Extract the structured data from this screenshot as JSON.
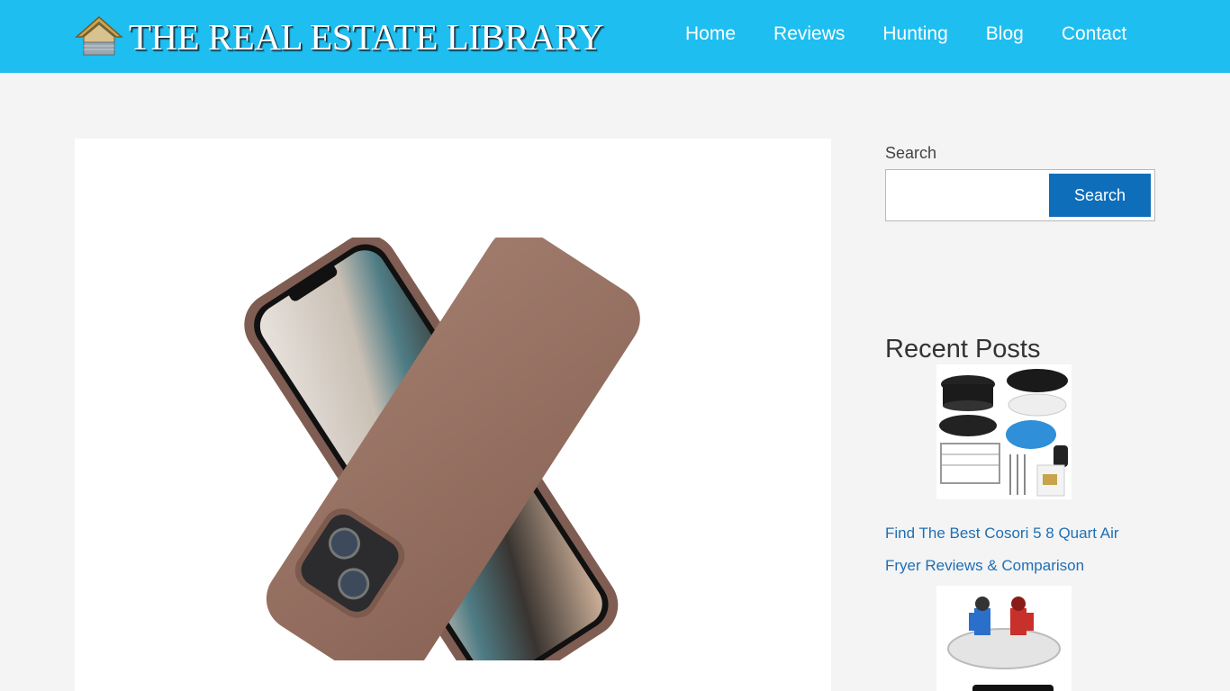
{
  "site": {
    "logo_text": "THE REAL ESTATE LIBRARY",
    "logo_icon": "house-icon",
    "header_color": "#1ebef0"
  },
  "nav": {
    "items": [
      {
        "label": "Home"
      },
      {
        "label": "Reviews"
      },
      {
        "label": "Hunting"
      },
      {
        "label": "Blog"
      },
      {
        "label": "Contact"
      }
    ]
  },
  "article": {
    "image": "brown-iphone-silicone-case-product-image"
  },
  "sidebar": {
    "search": {
      "label": "Search",
      "placeholder": "",
      "value": "",
      "button_label": "Search",
      "button_color": "#0f6eba"
    },
    "recent_posts": {
      "title": "Recent Posts",
      "posts": [
        {
          "thumbnail": "air-fryer-accessories-image",
          "title": "Find The Best Cosori 5 8 Quart Air Fryer Reviews & Comparison"
        },
        {
          "thumbnail": "robot-battle-toy-image",
          "title": ""
        }
      ]
    },
    "link_color": "#1f6fb5"
  }
}
